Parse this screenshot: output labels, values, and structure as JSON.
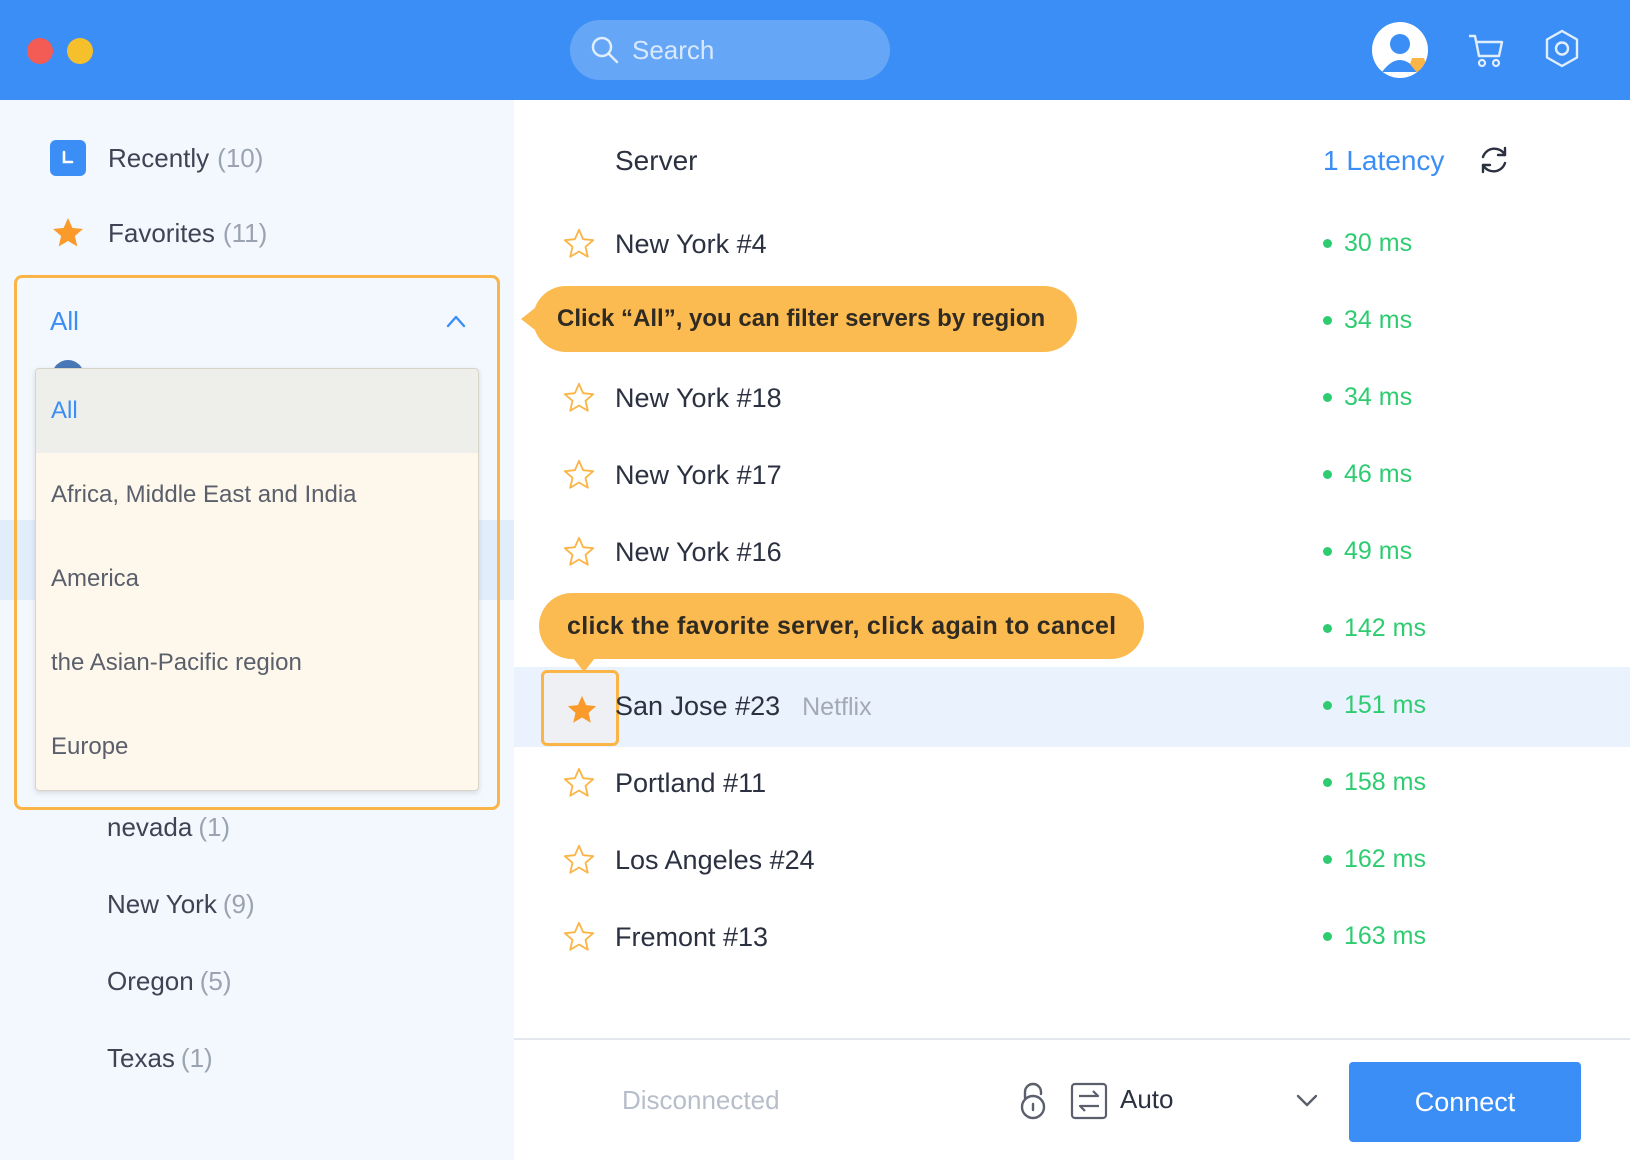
{
  "header": {
    "search_placeholder": "Search",
    "icons": [
      "search-icon",
      "avatar",
      "cart-icon",
      "settings-icon"
    ]
  },
  "sidebar": {
    "recently": {
      "label": "Recently",
      "count": "(10)"
    },
    "favorites": {
      "label": "Favorites",
      "count": "(11)"
    },
    "region_filter": {
      "selected": "All",
      "options": [
        "All",
        "Africa, Middle East and India",
        "America",
        "the Asian-Pacific region",
        "Europe"
      ]
    },
    "states": [
      {
        "label": "nevada",
        "count": "(1)"
      },
      {
        "label": "New York",
        "count": "(9)"
      },
      {
        "label": "Oregon",
        "count": "(5)"
      },
      {
        "label": "Texas",
        "count": "(1)"
      }
    ]
  },
  "server_list": {
    "col_server": "Server",
    "col_latency": "1 Latency",
    "rows": [
      {
        "name": "New York #4",
        "latency": "30 ms"
      },
      {
        "name": "",
        "latency": "34 ms"
      },
      {
        "name": "New York #18",
        "latency": "34 ms"
      },
      {
        "name": "New York #17",
        "latency": "46 ms"
      },
      {
        "name": "New York #16",
        "latency": "49 ms"
      },
      {
        "name": "",
        "latency": "142 ms"
      },
      {
        "name": "San Jose #23",
        "tag": "Netflix",
        "latency": "151 ms",
        "favorite": true
      },
      {
        "name": "Portland #11",
        "latency": "158 ms"
      },
      {
        "name": "Los Angeles #24",
        "latency": "162 ms"
      },
      {
        "name": "Fremont #13",
        "latency": "163 ms"
      }
    ]
  },
  "tooltips": {
    "filter_hint": "Click “All”, you can filter servers by region",
    "favorite_hint": "click the favorite server, click again to cancel"
  },
  "bottom": {
    "status": "Disconnected",
    "mode": "Auto",
    "connect_label": "Connect"
  },
  "colors": {
    "accent": "#3b8ef5",
    "highlight": "#fbb546",
    "latency_good": "#2ecc71"
  }
}
